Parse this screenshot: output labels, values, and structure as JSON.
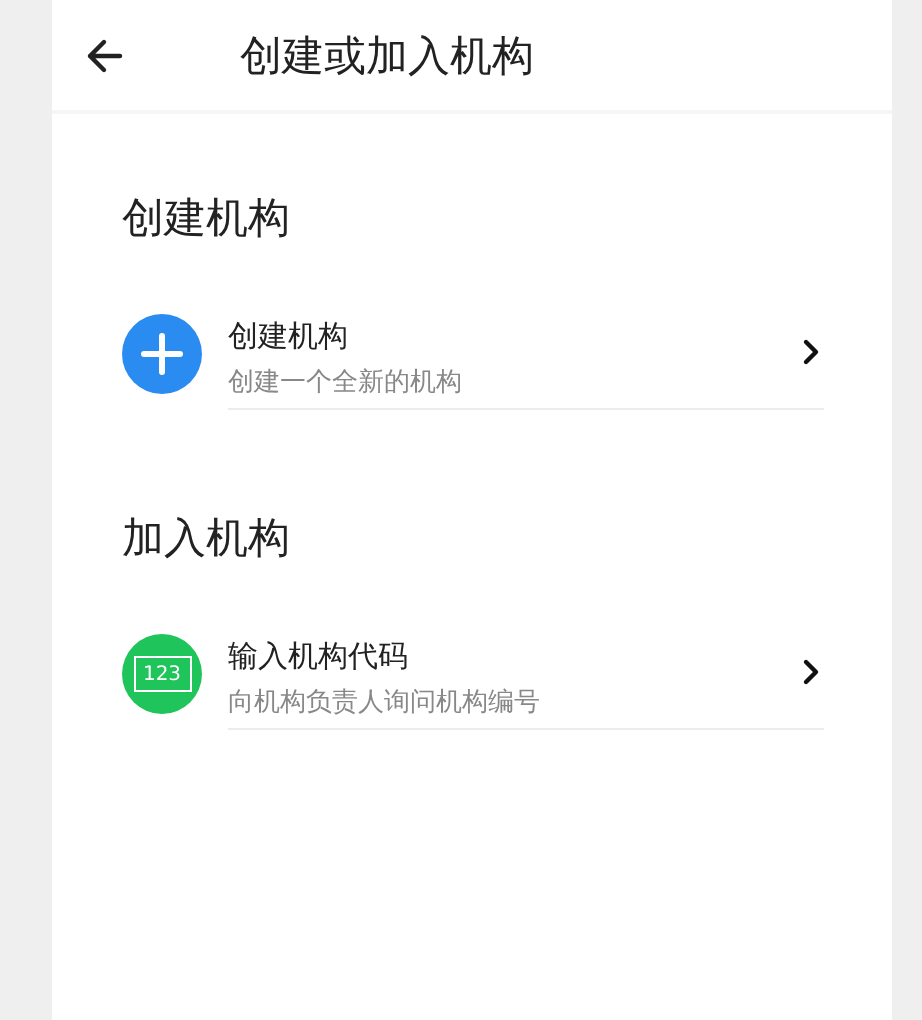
{
  "header": {
    "title": "创建或加入机构"
  },
  "sections": [
    {
      "title": "创建机构",
      "items": [
        {
          "kind": "plus",
          "title": "创建机构",
          "subtitle": "创建一个全新的机构"
        }
      ]
    },
    {
      "title": "加入机构",
      "items": [
        {
          "kind": "code",
          "icon_text": "123",
          "title": "输入机构代码",
          "subtitle": "向机构负责人询问机构编号"
        }
      ]
    }
  ]
}
